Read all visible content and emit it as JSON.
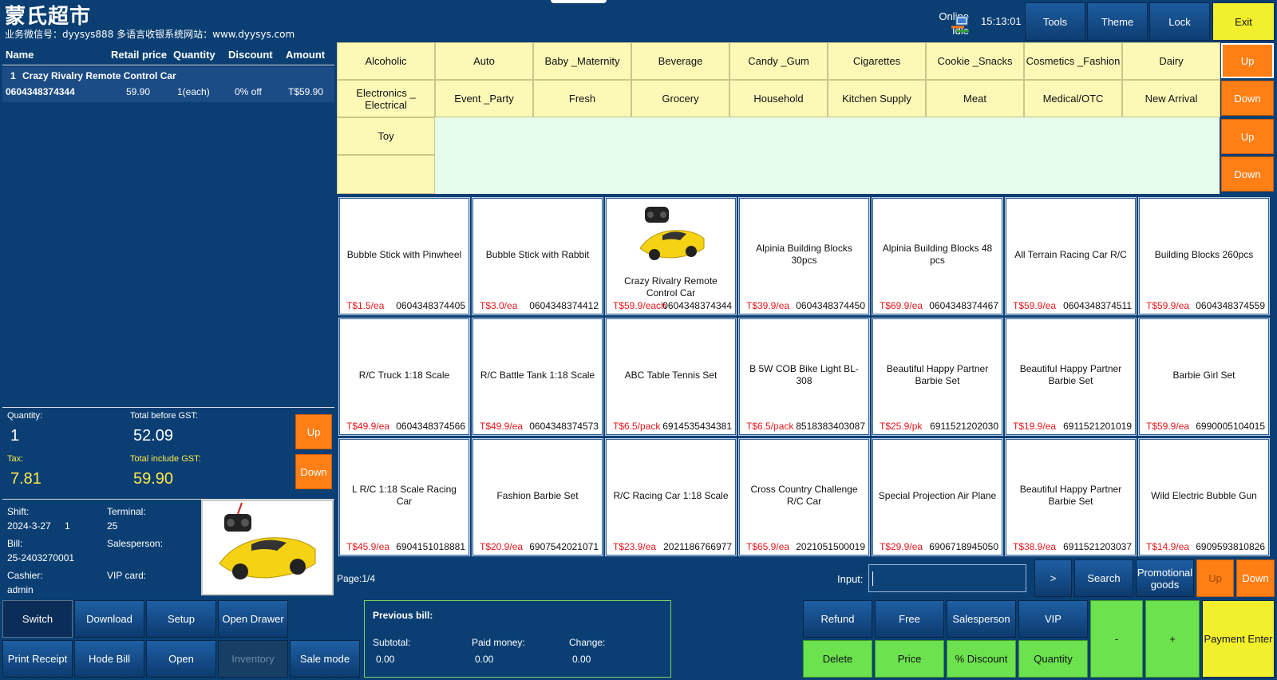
{
  "header": {
    "store_name": "蒙氏超市",
    "store_sub": "业务微信号：dyysys888 多语言收银系统网站：www.dyysys.com",
    "status_online": "Online",
    "status_idle": "Idle",
    "clock": "15:13:01",
    "buttons": [
      "Tools",
      "Theme",
      "Lock",
      "Exit"
    ]
  },
  "receipt": {
    "columns": [
      "Name",
      "Retail price",
      "Quantity",
      "Discount",
      "Amount"
    ],
    "rows": [
      {
        "index": "1",
        "name": "Crazy Rivalry Remote Control Car",
        "code": "0604348374344",
        "price": "59.90",
        "qty": "1(each)",
        "discount": "0% off",
        "amount": "T$59.90"
      }
    ]
  },
  "totals": {
    "quantity_label": "Quantity:",
    "quantity": "1",
    "before_gst_label": "Total before GST:",
    "before_gst": "52.09",
    "tax_label": "Tax:",
    "tax": "7.81",
    "incl_gst_label": "Total include GST:",
    "incl_gst": "59.90",
    "up": "Up",
    "down": "Down"
  },
  "info": {
    "shift_label": "Shift:",
    "shift_date": "2024-3-27",
    "shift_no": "1",
    "terminal_label": "Terminal:",
    "terminal": "25",
    "bill_label": "Bill:",
    "bill": "25-2403270001",
    "salesperson_label": "Salesperson:",
    "cashier_label": "Cashier:",
    "cashier": "admin",
    "vip_label": "VIP card:"
  },
  "categories": [
    "Alcoholic",
    "Auto",
    "Baby _Maternity",
    "Beverage",
    "Candy _Gum",
    "Cigarettes",
    "Cookie _Snacks",
    "Cosmetics _Fashion",
    "Dairy",
    "Electronics _ Electrical",
    "Event _Party",
    "Fresh",
    "Grocery",
    "Household",
    "Kitchen Supply",
    "Meat",
    "Medical/OTC",
    "New Arrival",
    "Toy"
  ],
  "cat_nav": [
    "Up",
    "Down",
    "Up",
    "Down"
  ],
  "products": [
    {
      "name": "Bubble Stick with Pinwheel",
      "price": "T$1.5/ea",
      "code": "0604348374405"
    },
    {
      "name": "Bubble Stick with Rabbit",
      "price": "T$3.0/ea",
      "code": "0604348374412"
    },
    {
      "name": "Crazy Rivalry Remote Control Car",
      "price": "T$59.9/each",
      "code": "0604348374344",
      "image": true
    },
    {
      "name": "Alpinia Building Blocks 30pcs",
      "price": "T$39.9/ea",
      "code": "0604348374450"
    },
    {
      "name": "Alpinia Building Blocks 48 pcs",
      "price": "T$69.9/ea",
      "code": "0604348374467"
    },
    {
      "name": "All Terrain Racing Car R/C",
      "price": "T$59.9/ea",
      "code": "0604348374511"
    },
    {
      "name": "Building Blocks 260pcs",
      "price": "T$59.9/ea",
      "code": "0604348374559"
    },
    {
      "name": "R/C Truck 1:18 Scale",
      "price": "T$49.9/ea",
      "code": "0604348374566"
    },
    {
      "name": "R/C Battle Tank 1:18 Scale",
      "price": "T$49.9/ea",
      "code": "0604348374573"
    },
    {
      "name": "ABC Table Tennis Set",
      "price": "T$6.5/pack",
      "code": "6914535434381"
    },
    {
      "name": "B 5W COB Bike Light BL-308",
      "price": "T$6.5/pack",
      "code": "8518383403087"
    },
    {
      "name": "Beautiful Happy Partner Barbie Set",
      "price": "T$25.9/pk",
      "code": "6911521202030"
    },
    {
      "name": "Beautiful Happy Partner Barbie Set",
      "price": "T$19.9/ea",
      "code": "6911521201019"
    },
    {
      "name": "Barbie Girl Set",
      "price": "T$59.9/ea",
      "code": "6990005104015"
    },
    {
      "name": "L R/C 1:18 Scale Racing Car",
      "price": "T$45.9/ea",
      "code": "6904151018881"
    },
    {
      "name": "Fashion Barbie Set",
      "price": "T$20.9/ea",
      "code": "6907542021071"
    },
    {
      "name": "R/C Racing Car 1:18 Scale",
      "price": "T$23.9/ea",
      "code": "2021186766977"
    },
    {
      "name": "Cross Country Challenge R/C Car",
      "price": "T$65.9/ea",
      "code": "2021051500019"
    },
    {
      "name": "Special Projection Air Plane",
      "price": "T$29.9/ea",
      "code": "6906718945050"
    },
    {
      "name": "Beautiful Happy Partner Barbie Set",
      "price": "T$38.9/ea",
      "code": "6911521203037"
    },
    {
      "name": "Wild Electric Bubble Gun",
      "price": "T$14.9/ea",
      "code": "6909593810826"
    }
  ],
  "pager": {
    "page": "Page:1/4",
    "input_label": "Input:",
    "next": ">",
    "search": "Search",
    "promo": "Promotional goods",
    "up": "Up",
    "down": "Down"
  },
  "left_buttons": [
    "Switch",
    "Download",
    "Setup",
    "Open Drawer",
    "Print Receipt",
    "Hode Bill",
    "Open",
    "Inventory",
    "Sale mode"
  ],
  "prev_bill": {
    "title": "Previous bill:",
    "subtotal_label": "Subtotal:",
    "subtotal": "0.00",
    "paid_label": "Paid money:",
    "paid": "0.00",
    "change_label": "Change:",
    "change": "0.00"
  },
  "right_buttons": {
    "row1": [
      "Refund",
      "Free",
      "Salesperson",
      "VIP"
    ],
    "row2": [
      "Delete",
      "Price",
      "% Discount",
      "Quantity"
    ],
    "minus": "-",
    "plus": "+",
    "pay": "Payment Enter"
  }
}
